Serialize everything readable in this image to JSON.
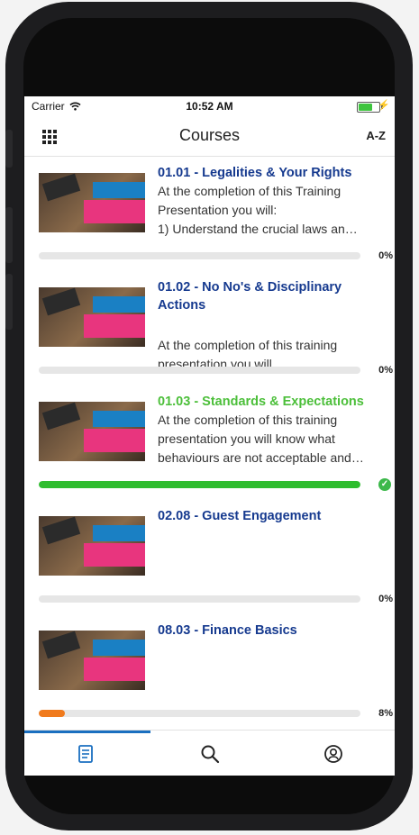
{
  "status_bar": {
    "carrier": "Carrier",
    "time": "10:52 AM",
    "battery_level": 0.7,
    "battery_color": "#3ec43e"
  },
  "navbar": {
    "title": "Courses",
    "grid_icon": "grid-icon",
    "sort_label": "A-Z"
  },
  "courses": [
    {
      "title": "01.01 - Legalities & Your Rights",
      "description": "At the completion of this Training Presentation you will:\n1)   Understand the crucial laws an…",
      "progress": 0,
      "progress_label": "0%",
      "title_color": "#163a8f",
      "fill_color": "#e6e6e6"
    },
    {
      "title": "01.02 - No No's & Disciplinary Actions",
      "description": "At the completion of this training presentation you will…",
      "progress": 0,
      "progress_label": "0%",
      "title_color": "#163a8f",
      "fill_color": "#e6e6e6"
    },
    {
      "title": "01.03 - Standards & Expectations",
      "description": "At the completion of this training presentation you will know what behaviours are not acceptable and…",
      "progress": 100,
      "progress_label": "",
      "completed_icon": "check-circle-icon",
      "title_color": "#4cbf3a",
      "fill_color": "#2fbd2f"
    },
    {
      "title": "02.08 - Guest Engagement",
      "description": "",
      "progress": 0,
      "progress_label": "0%",
      "title_color": "#163a8f",
      "fill_color": "#e6e6e6"
    },
    {
      "title": "08.03 - Finance Basics",
      "description": "",
      "progress": 8,
      "progress_label": "8%",
      "title_color": "#163a8f",
      "fill_color": "#f07a1c"
    }
  ],
  "tabbar": {
    "tabs": [
      {
        "icon": "courses-list-icon",
        "active": true
      },
      {
        "icon": "search-icon",
        "active": false
      },
      {
        "icon": "profile-icon",
        "active": false
      }
    ],
    "accent": "#1a6fc0"
  }
}
